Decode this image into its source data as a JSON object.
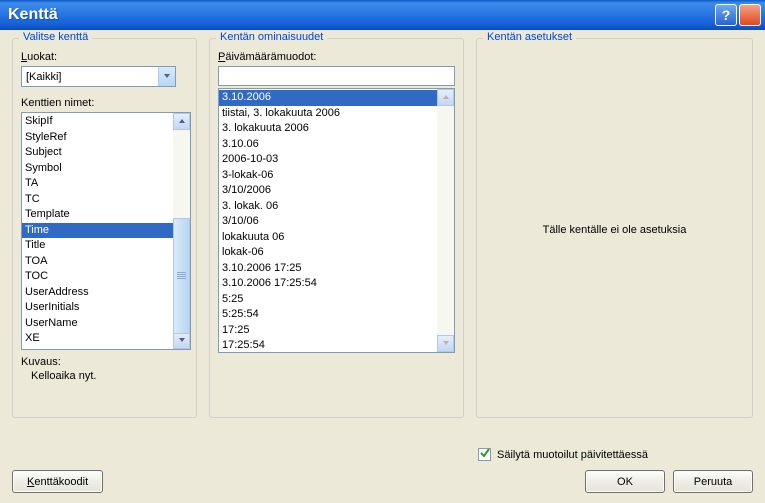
{
  "window": {
    "title": "Kenttä"
  },
  "col1": {
    "legend": "Valitse kenttä",
    "categories_label_pre": "L",
    "categories_label_rest": "uokat:",
    "categories_value": "[Kaikki]",
    "names_label_pre": "Kenttien nimet",
    "names_label_suf": ":",
    "names": [
      "SkipIf",
      "StyleRef",
      "Subject",
      "Symbol",
      "TA",
      "TC",
      "Template",
      "Time",
      "Title",
      "TOA",
      "TOC",
      "UserAddress",
      "UserInitials",
      "UserName",
      "XE"
    ],
    "names_selected": "Time",
    "desc_label": "Kuvaus:",
    "desc_value": "Kelloaika nyt."
  },
  "col2": {
    "legend": "Kentän ominaisuudet",
    "formats_label_pre": "P",
    "formats_label_rest": "äivämäärämuodot:",
    "input_value": "",
    "formats": [
      "3.10.2006",
      "tiistai, 3. lokakuuta 2006",
      "3. lokakuuta 2006",
      "3.10.06",
      "2006-10-03",
      "3-lokak-06",
      "3/10/2006",
      "3. lokak. 06",
      "3/10/06",
      "lokakuuta 06",
      "lokak-06",
      "3.10.2006 17:25",
      "3.10.2006 17:25:54",
      "5:25",
      "5:25:54",
      "17:25",
      "17:25:54"
    ],
    "formats_selected": "3.10.2006"
  },
  "col3": {
    "legend": "Kentän asetukset",
    "message": "Tälle kentälle ei ole asetuksia"
  },
  "preserve": {
    "checked": true,
    "label_pre": "S",
    "label_rest": "äilytä muotoilut päivitettäessä"
  },
  "buttons": {
    "field_codes_pre": "K",
    "field_codes_rest": "enttäkoodit",
    "ok": "OK",
    "cancel": "Peruuta"
  }
}
